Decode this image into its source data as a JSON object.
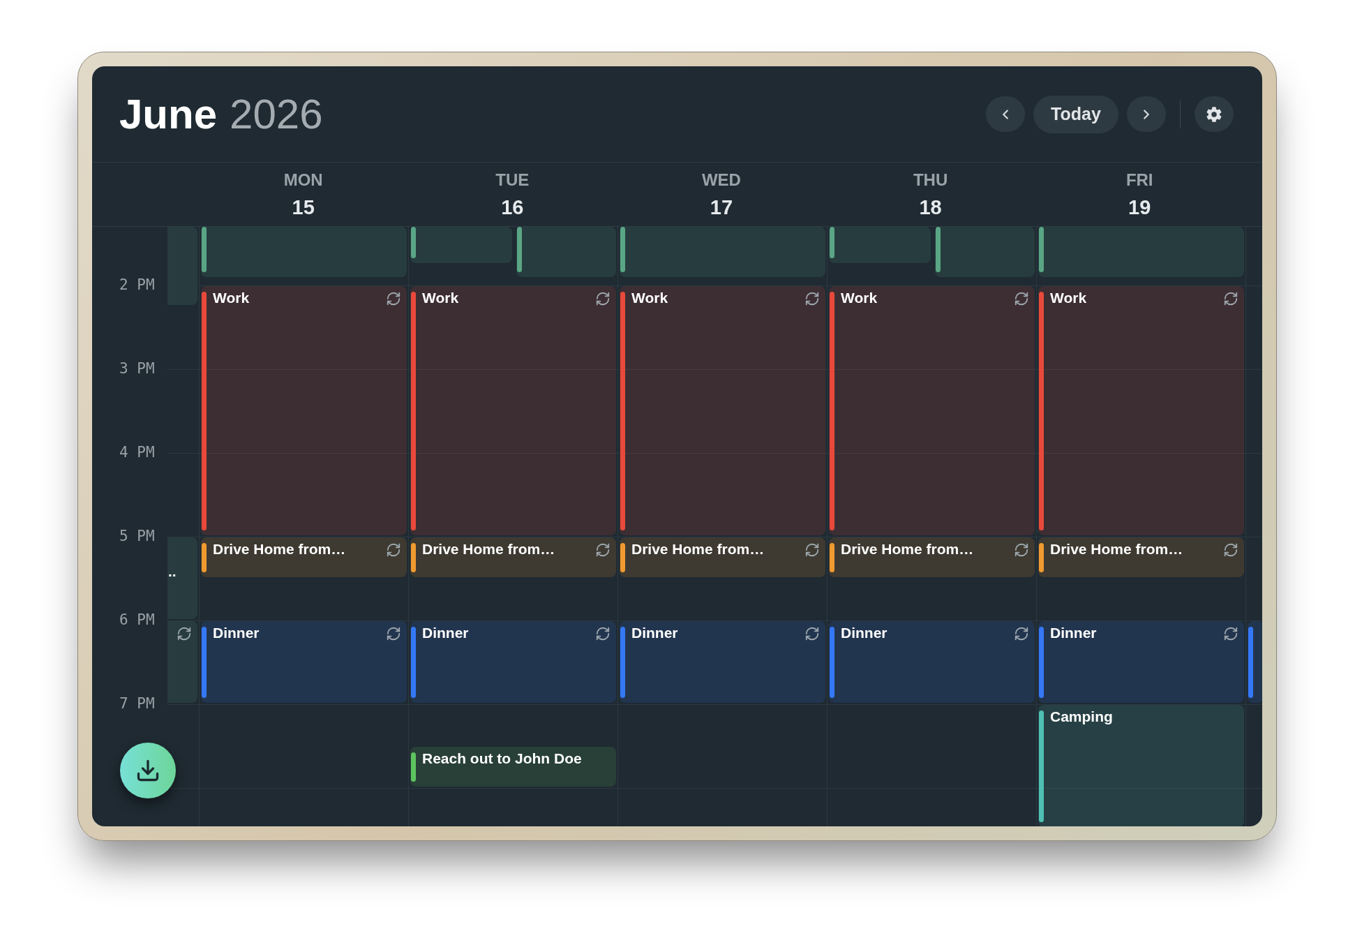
{
  "header": {
    "month": "June",
    "year": "2026",
    "today_button": "Today"
  },
  "columns": [
    {
      "kind": "partial-start",
      "events": [
        {
          "color": "#283c3f"
        },
        {
          "title": "..",
          "color": "#283c3f",
          "recurring": false
        },
        {
          "color": "#283c3f",
          "recurring": true
        }
      ]
    },
    {
      "kind": "day",
      "weekday": "MON",
      "date": "15",
      "events": [
        {
          "color": "#5aa585"
        },
        {
          "title": "Work",
          "color": "#e8493a",
          "recurring": true
        },
        {
          "title": "Drive Home from…",
          "color": "#f09a30",
          "recurring": true
        },
        {
          "title": "Dinner",
          "color": "#3478f6",
          "recurring": true
        }
      ]
    },
    {
      "kind": "day",
      "weekday": "TUE",
      "date": "16",
      "events": [
        {
          "color": "#5aa585"
        },
        {
          "color": "#5aa585"
        },
        {
          "title": "Work",
          "color": "#e8493a",
          "recurring": true
        },
        {
          "title": "Drive Home from…",
          "color": "#f09a30",
          "recurring": true
        },
        {
          "title": "Dinner",
          "color": "#3478f6",
          "recurring": true
        },
        {
          "title": "Reach out to John Doe",
          "color": "#5ec45e",
          "recurring": false
        }
      ]
    },
    {
      "kind": "day",
      "weekday": "WED",
      "date": "17",
      "events": [
        {
          "color": "#5aa585"
        },
        {
          "title": "Work",
          "color": "#e8493a",
          "recurring": true
        },
        {
          "title": "Drive Home from…",
          "color": "#f09a30",
          "recurring": true
        },
        {
          "title": "Dinner",
          "color": "#3478f6",
          "recurring": true
        }
      ]
    },
    {
      "kind": "day",
      "weekday": "THU",
      "date": "18",
      "events": [
        {
          "color": "#5aa585"
        },
        {
          "color": "#5aa585"
        },
        {
          "title": "Work",
          "color": "#e8493a",
          "recurring": true
        },
        {
          "title": "Drive Home from…",
          "color": "#f09a30",
          "recurring": true
        },
        {
          "title": "Dinner",
          "color": "#3478f6",
          "recurring": true
        }
      ]
    },
    {
      "kind": "day",
      "weekday": "FRI",
      "date": "19",
      "events": [
        {
          "color": "#5aa585"
        },
        {
          "title": "Work",
          "color": "#e8493a",
          "recurring": true
        },
        {
          "title": "Drive Home from…",
          "color": "#f09a30",
          "recurring": true
        },
        {
          "title": "Dinner",
          "color": "#3478f6",
          "recurring": true
        },
        {
          "title": "Camping",
          "color": "#4fc0b4",
          "recurring": false
        }
      ]
    },
    {
      "kind": "partial-end",
      "events": [
        {
          "color": "#3478f6"
        }
      ]
    }
  ],
  "time_labels": [
    "2 PM",
    "3 PM",
    "4 PM",
    "5 PM",
    "6 PM",
    "7 PM"
  ]
}
